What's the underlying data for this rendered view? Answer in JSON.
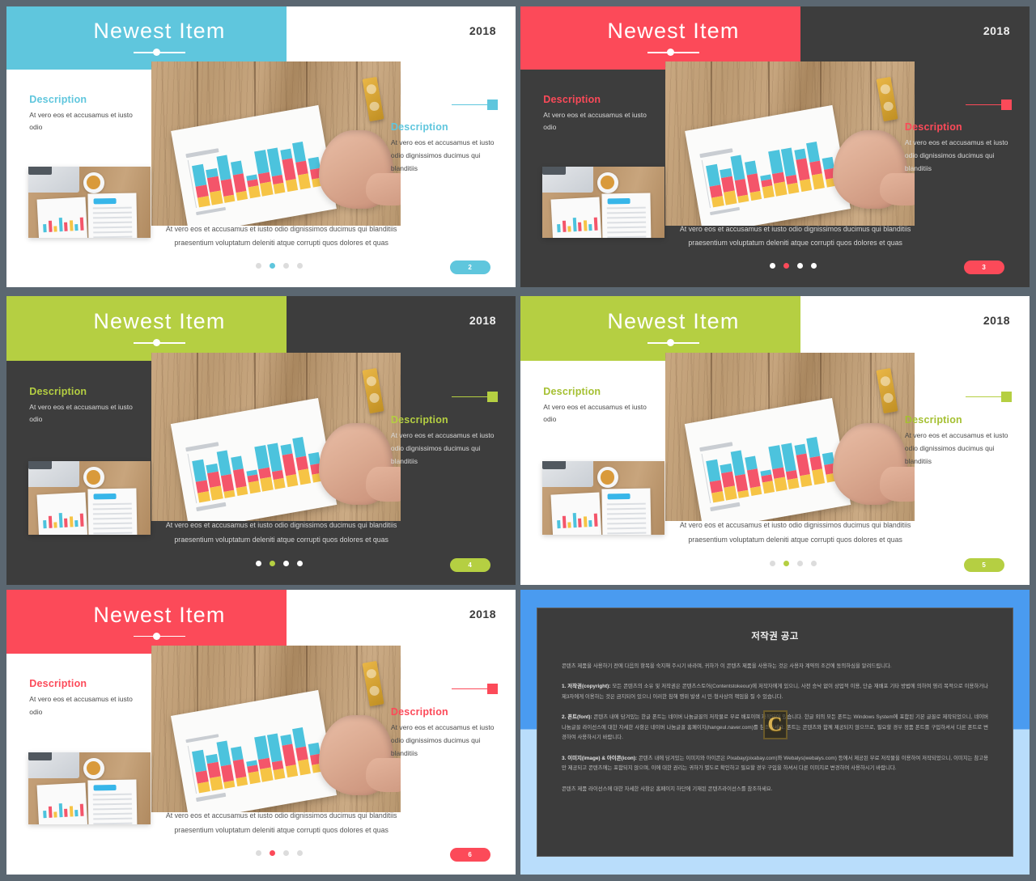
{
  "meta": {
    "background_color": "#5b6771",
    "slide_count": 5
  },
  "common": {
    "title": "Newest Item",
    "year": "2018",
    "desc_heading": "Description",
    "desc_left_body": "At vero eos et accusamus et iusto odio",
    "desc_right_body": "At vero eos et accusamus et iusto odio dignissimos ducimus qui blanditiis",
    "caption": "At vero eos et accusamus et iusto odio dignissimos ducimus qui blanditiis praesentium voluptatum deleniti atque corrupti quos dolores et quas",
    "dot_count": 4
  },
  "slides": [
    {
      "id": "slide-1",
      "theme": "light",
      "accent": "#5fc6dd",
      "page_label": "2",
      "active_dot": 1,
      "title": "Newest Item",
      "year": "2018"
    },
    {
      "id": "slide-2",
      "theme": "dark",
      "accent": "#fc4a59",
      "page_label": "3",
      "active_dot": 1,
      "title": "Newest Item",
      "year": "2018"
    },
    {
      "id": "slide-3",
      "theme": "dark",
      "accent": "#b5cf42",
      "page_label": "4",
      "active_dot": 1,
      "title": "Newest Item",
      "year": "2018"
    },
    {
      "id": "slide-4",
      "theme": "light",
      "accent": "#b5cf42",
      "page_label": "5",
      "active_dot": 1,
      "title": "Newest Item",
      "year": "2018"
    },
    {
      "id": "slide-5",
      "theme": "light",
      "accent": "#fc4a59",
      "page_label": "6",
      "active_dot": 1,
      "title": "Newest Item",
      "year": "2018"
    }
  ],
  "notice": {
    "border_top_color": "#4a9bf0",
    "border_bottom_color": "#b9ddfb",
    "title": "저작권 공고",
    "intro": "콘텐츠 제품을 사용하기 전에 다음의 항목을 숙지해 주시기 바라며, 귀하가 이 콘텐츠 제품을 사용하는 것은 사용자 계약의 조건에 동의하심을 알려드립니다.",
    "sections": [
      {
        "label": "1. 저작권(copyright):",
        "text": " 모든 콘텐츠의 소유 및 저작권은 콘텐츠스토어(Contentstokeour)에 저작자에게 있으니, 사전 승낙 없이 상업적 이용, 단순 재배포 기타 방법에 의하여 영리 목적으로 이용하거나 제3자에게 이용하는 것은 금지되어 있으니 이러한 침해 행위 발생 시 민·형사상의 책임을 질 수 있습니다."
      },
      {
        "label": "2. 폰트(font):",
        "text": " 콘텐츠 내에 담겨있는 한글 폰트는 네이버 나눔글꼴의 저작물로 무료 배포이며 저작되어 있습니다. 한글 외의 모든 폰트는 Windows System에 포함된 기본 글꼴로 제작되었으니, 네이버 나눔글꼴 라이선스에 대한 자세한 사항은 네이버 나눔글꼴 홈페이지(hangeul.naver.com)를 참조하세요. 폰트는 콘텐츠와 함께 제공되지 않으므로, 필요할 경우 정품 폰트를 구입하셔서 다른 폰트로 변경하여 사용하시기 바랍니다."
      },
      {
        "label": "3. 이미지(image) & 아이콘(icon):",
        "text": " 콘텐츠 내에 담겨있는 이미지와 아이콘은 Pixabay(pixabay.com)와 Webalys(webalys.com) 등에서 제공된 무료 저작물을 이용하여 저작되었으니, 이미지는 참고용만 제공되고 콘텐츠에는 포함되지 않으며, 이에 대한 권리는 귀하가 별도로 확인하고 필요할 경우 구입을 하셔서 다른 이미지로 변경하여 사용하시기 바랍니다."
      }
    ],
    "footer": "콘텐츠 제품 라이선스에 대한 자세한 사항은 홈페이지 하단에 기재된 콘텐츠라이선스를 참조하세요.",
    "watermark_letter": "C"
  }
}
